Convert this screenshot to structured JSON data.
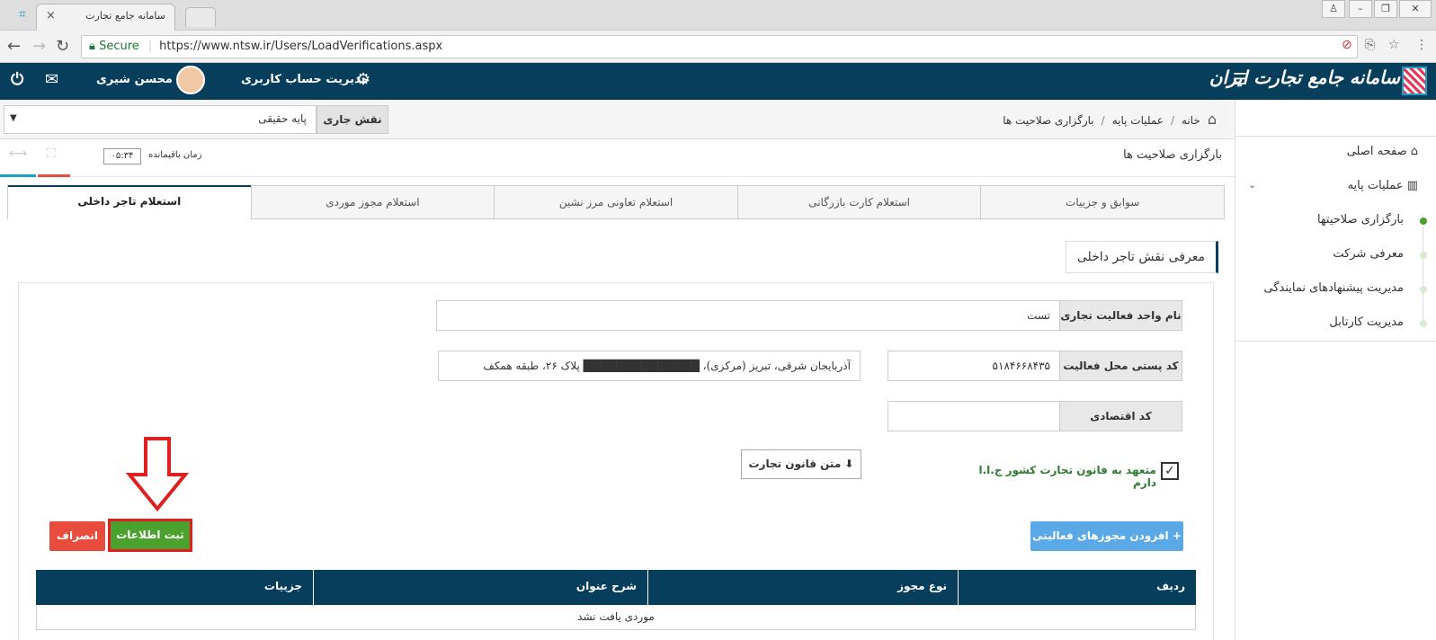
{
  "browser": {
    "tab_title": "سامانه جامع تجارت",
    "secure_label": "Secure",
    "url": "https://www.ntsw.ir/Users/LoadVerifications.aspx"
  },
  "header": {
    "app_title": "سامانه جامع تجارت ایران",
    "user_name": "محسن شیری",
    "account_mgmt": "مدیریت حساب کاربری"
  },
  "breadcrumb": {
    "home": "خانه",
    "level1": "عملیات پایه",
    "level2": "بارگزاری صلاحیت ها"
  },
  "role": {
    "label": "نقش جاری",
    "value": "پایه حقیقی"
  },
  "page": {
    "title": "بارگزاری صلاحیت ها",
    "timer_label": "زمان باقیمانده",
    "timer_value": "۰۵:۳۴"
  },
  "tabs": [
    {
      "label": "سوابق و جزییات",
      "active": false
    },
    {
      "label": "استعلام کارت بازرگانی",
      "active": false
    },
    {
      "label": "استعلام تعاونی مرز نشین",
      "active": false
    },
    {
      "label": "استعلام مجوز موردی",
      "active": false
    },
    {
      "label": "استعلام تاجر داخلی",
      "active": true
    }
  ],
  "section_title": "معرفی نقش تاجر داخلی",
  "form": {
    "business_name_label": "نام واحد فعالیت تجاری",
    "business_name_value": "تست",
    "postal_label": "کد پستی محل فعالیت",
    "postal_value": "۵۱۸۴۶۶۸۴۳۵",
    "address_value": "آذربایجان شرقی، تبریز (مرکزی)، ██████████████ پلاک ۲۶، طبقه همکف",
    "economic_code_label": "کد اقتصادی",
    "economic_code_value": "",
    "commit_label": "متعهد به قانون تجارت کشور ج.ا.ا دارم",
    "commit_checked": true,
    "law_text_button": "متن قانون تجارت"
  },
  "actions": {
    "add_licenses": "افزودن مجوزهای فعالیتی",
    "save": "ثبت اطلاعات",
    "cancel": "انصراف"
  },
  "table": {
    "headers": [
      "ردیف",
      "نوع مجوز",
      "شرح عنوان",
      "جزییات"
    ],
    "empty_message": "موردی یافت نشد"
  },
  "sidebar": {
    "items": [
      {
        "label": "صفحه اصلی"
      },
      {
        "label": "عملیات پایه"
      }
    ],
    "subitems": [
      {
        "label": "بارگزاری صلاحیتها",
        "active": true
      },
      {
        "label": "معرفی شرکت",
        "active": false
      },
      {
        "label": "مدیریت پیشنهادهای نمایندگی",
        "active": false
      },
      {
        "label": "مدیریت کارتابل",
        "active": false
      }
    ]
  },
  "colors": {
    "primary": "#063e5c",
    "save": "#4aa12e",
    "cancel": "#e74c3c",
    "add": "#5aa9e6",
    "highlight": "#e02020"
  }
}
